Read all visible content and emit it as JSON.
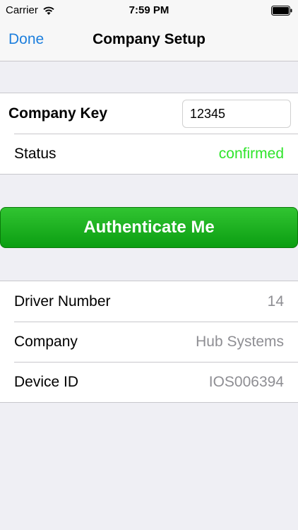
{
  "status_bar": {
    "carrier": "Carrier",
    "time": "7:59 PM"
  },
  "nav": {
    "done_label": "Done",
    "title": "Company Setup"
  },
  "company_section": {
    "key_label": "Company Key",
    "key_value": "12345",
    "status_label": "Status",
    "status_value": "confirmed",
    "status_color": "#2fe42b"
  },
  "auth_button": {
    "label": "Authenticate Me",
    "color": "#0b9e12"
  },
  "info_section": {
    "rows": [
      {
        "label": "Driver Number",
        "value": "14"
      },
      {
        "label": "Company",
        "value": "Hub Systems"
      },
      {
        "label": "Device ID",
        "value": "IOS006394"
      }
    ]
  },
  "colors": {
    "accent": "#1d7fdd",
    "background": "#efeff4"
  }
}
